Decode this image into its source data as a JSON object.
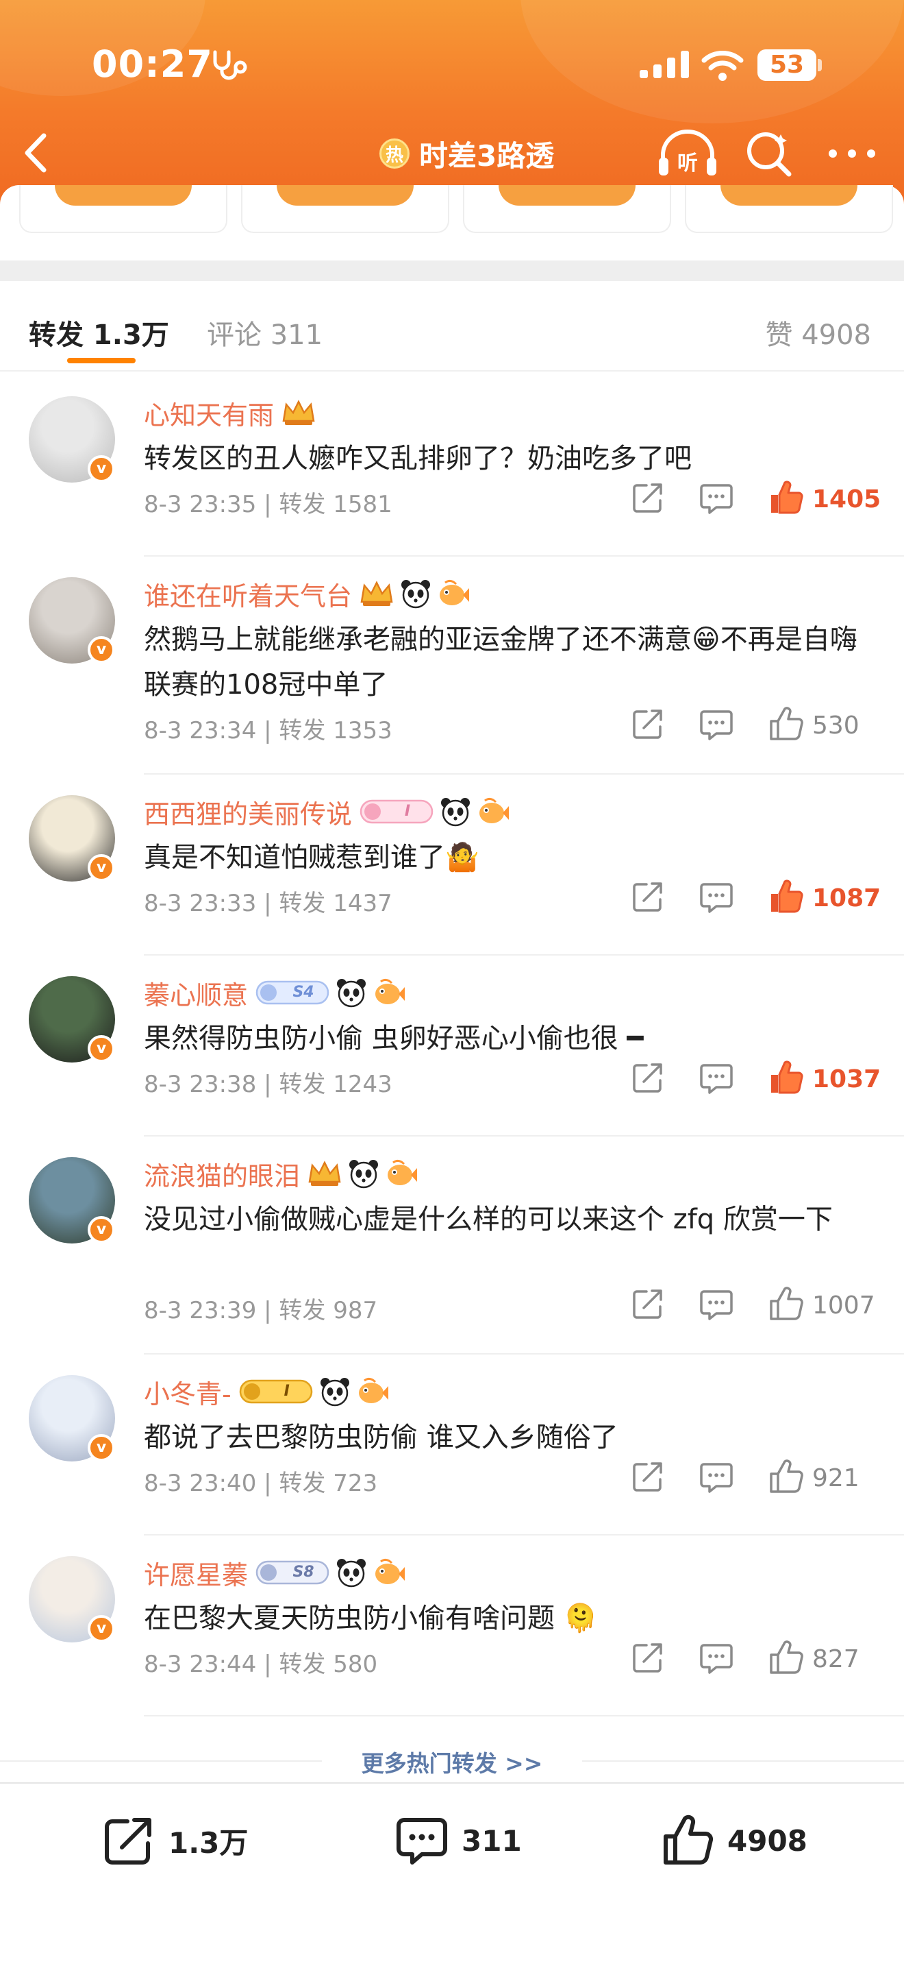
{
  "status_bar": {
    "time": "00:27",
    "battery": "53"
  },
  "nav": {
    "hot_badge": "热",
    "title": "时差3路透",
    "listen": "听"
  },
  "tabs": {
    "forward": "转发 1.3万",
    "comment": "评论 311",
    "like": "赞 4908"
  },
  "items": [
    {
      "username": "心知天有雨",
      "text": "转发区的丑人嬷咋又乱排卵了？奶油吃多了吧",
      "meta": "8-3 23:35 | 转发 1581",
      "likes": "1405",
      "liked": true,
      "badges": [
        "crown-badge-icon"
      ],
      "level": ""
    },
    {
      "username": "谁还在听着天气台",
      "text": "然鹅马上就能继承老融的亚运金牌了还不满意😁不再是自嗨联赛的108冠中单了",
      "meta": "8-3 23:34 | 转发 1353",
      "likes": "530",
      "liked": false,
      "badges": [
        "crown-badge-icon",
        "panda-icon",
        "fish-icon"
      ],
      "level": ""
    },
    {
      "username": "西西狸的美丽传说",
      "text": "真是不知道怕贼惹到谁了🤷",
      "meta": "8-3 23:33 | 转发 1437",
      "likes": "1087",
      "liked": true,
      "badges": [
        "pink-level-badge",
        "panda-icon",
        "fish-icon"
      ],
      "level": "I"
    },
    {
      "username": "蓁心顺意",
      "text": "果然得防虫防小偷 虫卵好恶心小偷也很 ━",
      "meta": "8-3 23:38 | 转发 1243",
      "likes": "1037",
      "liked": true,
      "badges": [
        "blue-level-badge",
        "panda-icon",
        "fish-icon"
      ],
      "level": "S4"
    },
    {
      "username": "流浪猫的眼泪",
      "text": "没见过小偷做贼心虚是什么样的可以来这个 zfq 欣赏一下",
      "meta": "8-3 23:39 | 转发 987",
      "likes": "1007",
      "liked": false,
      "badges": [
        "crown-badge-icon",
        "panda-icon",
        "fish-icon"
      ],
      "level": ""
    },
    {
      "username": "小冬青-",
      "text": "都说了去巴黎防虫防偷 谁又入乡随俗了",
      "meta": "8-3 23:40 | 转发 723",
      "likes": "921",
      "liked": false,
      "badges": [
        "gold-level-badge",
        "panda-icon",
        "fish-icon"
      ],
      "level": "I"
    },
    {
      "username": "许愿星蓁",
      "text": "在巴黎大夏天防虫防小偷有啥问题 🫠",
      "meta": "8-3 23:44 | 转发 580",
      "likes": "827",
      "liked": false,
      "badges": [
        "butterfly-level-badge",
        "panda-icon",
        "fish-icon"
      ],
      "level": "S8"
    }
  ],
  "more_link": "更多热门转发 >>",
  "bottom_bar": {
    "forward": "1.3万",
    "comment": "311",
    "like": "4908"
  },
  "colors": {
    "accent_orange": "#ff8200",
    "username": "#eb7350",
    "liked": "#e8542c",
    "link_blue": "#5d7aa8"
  }
}
